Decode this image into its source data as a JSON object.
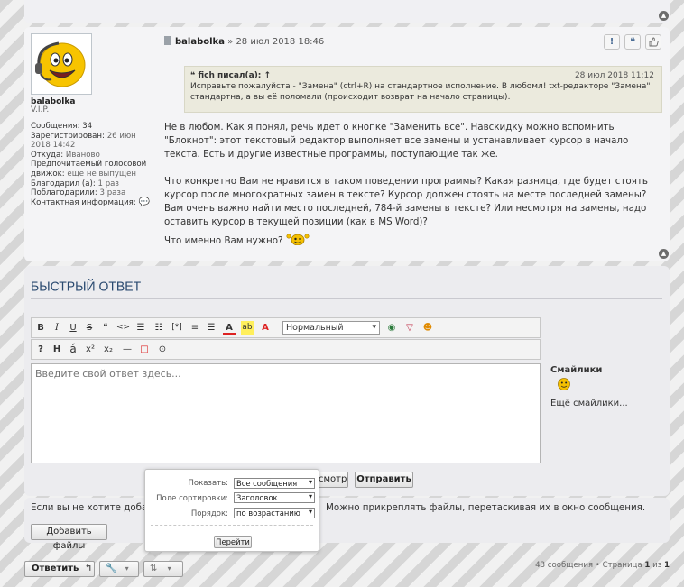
{
  "post": {
    "author": "balabolka",
    "rank": "V.I.P.",
    "date": "28 июл 2018 18:46",
    "date_sep": "»",
    "profile": [
      {
        "k": "Сообщения:",
        "v": "34"
      },
      {
        "k": "Зарегистрирован:",
        "v": "26 июн 2018 14:42"
      },
      {
        "k": "Откуда:",
        "v": "Иваново"
      },
      {
        "k": "Предпочитаемый голосовой движок:",
        "v": "ещё не выпущен"
      },
      {
        "k": "Благодарил (а):",
        "v": "1 раз"
      },
      {
        "k": "Поблагодарили:",
        "v": "3 раза"
      },
      {
        "k": "Контактная информация:",
        "v": ""
      }
    ],
    "quote": {
      "author_line": "fich писал(а): ↑",
      "date": "28 июл 2018 11:12",
      "text": "Исправьте пожалуйста - \"Замена\" (ctrl+R) на стандартное исполнение. В любомл! txt-редакторе \"Замена\" стандартна, а вы её поломали (происходит возврат на начало страницы)."
    },
    "paragraphs": [
      "Не в любом. Как я понял, речь идет о кнопке \"Заменить все\". Навскидку можно вспомнить \"Блокнот\": этот текстовый редактор выполняет все замены и устанавливает курсор в начало текста. Есть и другие известные программы, поступающие так же.",
      "Что конкретно Вам не нравится в таком поведении программы? Какая разница, где будет стоять курсор после многократных замен в тексте? Курсор должен стоять на месте последней замены? Вам очень важно найти место последней, 784-й замены в тексте? Или несмотря на замены, надо оставить курсор в текущей позиции (как в MS Word)?"
    ],
    "last_line": "Что именно Вам нужно?"
  },
  "quick_reply": {
    "title": "БЫСТРЫЙ ОТВЕТ",
    "font_size_value": "Нормальный",
    "placeholder": "Введите свой ответ здесь...",
    "smilies_heading": "Смайлики",
    "more_smilies": "Ещё смайлики...",
    "preview_label": "смотр",
    "submit_label": "Отправить"
  },
  "attachments": {
    "text_left": "Если вы не хотите добав",
    "text_right": "Можно прикреплять файлы, перетаскивая их в окно сообщения.",
    "add_files": "Добавить файлы"
  },
  "sort_popup": {
    "show_label": "Показать:",
    "show_value": "Все сообщения",
    "sort_label": "Поле сортировки:",
    "sort_value": "Заголовок",
    "order_label": "Порядок:",
    "order_value": "по возрастанию",
    "go_label": "Перейти"
  },
  "footer": {
    "reply_label": "Ответить",
    "count_text": "43 сообщения • Страница",
    "page": "1",
    "of": "из",
    "total": "1"
  },
  "colors": {
    "link_blue": "#2a4a70",
    "quote_bg": "#ebeadd"
  }
}
